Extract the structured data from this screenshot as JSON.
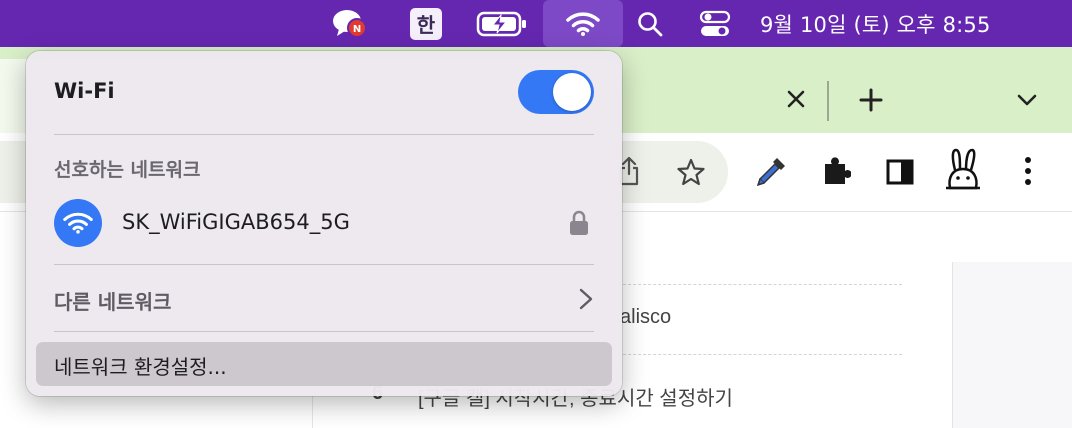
{
  "menubar": {
    "input_method_label": "한",
    "clock": "9월 10일 (토) 오후  8:55",
    "notification_badge": "N",
    "icons": [
      "chat-notification-icon",
      "input-method-icon",
      "battery-icon",
      "wifi-icon",
      "spotlight-search-icon",
      "control-center-icon"
    ]
  },
  "wifi_menu": {
    "title": "Wi-Fi",
    "toggle_on": true,
    "preferred_header": "선호하는 네트워크",
    "preferred_networks": [
      {
        "name": "SK_WiFiGIGAB654_5G",
        "secured": true
      }
    ],
    "other_networks_label": "다른 네트워크",
    "settings_label": "네트워크 환경설정..."
  },
  "browser": {
    "toolbar_icons": [
      "share-icon",
      "bookmark-star-icon",
      "eyedropper-icon",
      "extensions-icon",
      "sidebar-icon",
      "rabbit-extension-icon",
      "more-menu-icon"
    ],
    "tabstrip_icons": [
      "close-tab-icon",
      "new-tab-icon",
      "tab-list-icon"
    ],
    "content_line_1": "alisco",
    "content_number": "6",
    "content_line_2": "[구글 캘] 시작시간, 종료시간 설정하기"
  },
  "colors": {
    "menubar": "#6527b0",
    "toggle_on": "#3478f6",
    "tabstrip": "#d9efc8"
  }
}
